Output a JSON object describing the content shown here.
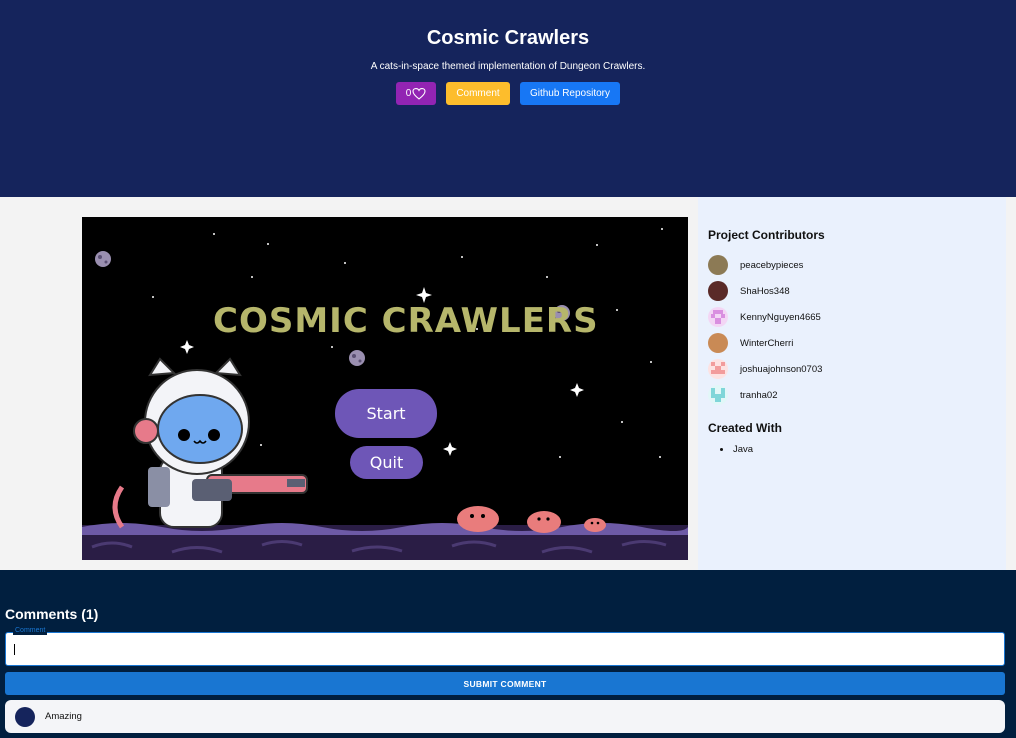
{
  "header": {
    "title": "Cosmic Crawlers",
    "subtitle": "A cats-in-space themed implementation of Dungeon Crawlers.",
    "like_count": "0",
    "comment_label": "Comment",
    "github_label": "Github Repository"
  },
  "game": {
    "title_text": "COSMIC CRAWLERS",
    "start_label": "Start",
    "quit_label": "Quit"
  },
  "sidebar": {
    "contributors_heading": "Project Contributors",
    "contributors": [
      {
        "name": "peacebypieces",
        "avatar_color": "#8c7a55"
      },
      {
        "name": "ShaHos348",
        "avatar_color": "#5a2a28"
      },
      {
        "name": "KennyNguyen4665",
        "avatar_color": "#d98fe0"
      },
      {
        "name": "WinterCherri",
        "avatar_color": "#c98a55"
      },
      {
        "name": "joshuajohnson0703",
        "avatar_color": "#f29c9c"
      },
      {
        "name": "tranha02",
        "avatar_color": "#7fd6d9"
      }
    ],
    "created_with_heading": "Created With",
    "languages": [
      "Java"
    ]
  },
  "comments": {
    "heading": "Comments (1)",
    "input_label": "Comment",
    "input_value": "",
    "submit_label": "SUBMIT COMMENT",
    "items": [
      {
        "text": "Amazing"
      }
    ]
  },
  "colors": {
    "header_bg": "#15245c",
    "comments_bg": "#011f3f",
    "like_button": "#9224b3",
    "comment_button": "#fdbd2c",
    "github_button": "#1777f5",
    "submit_button": "#1976d2"
  }
}
